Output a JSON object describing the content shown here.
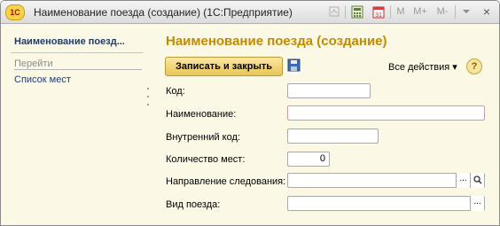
{
  "window": {
    "title": "Наименование поезда (создание)  (1С:Предприятие)",
    "app_icon_text": "1С",
    "toolbar": {
      "m_label": "M",
      "m_plus_label": "M+",
      "m_minus_label": "M-",
      "close_label": "×"
    }
  },
  "left_panel": {
    "title": "Наименование поезд...",
    "section": "Перейти",
    "links": [
      "Список мест"
    ]
  },
  "form": {
    "title": "Наименование поезда (создание)",
    "save_close_label": "Записать и закрыть",
    "all_actions_label": "Все действия ▾",
    "help_label": "?",
    "fields": {
      "code_label": "Код:",
      "code_value": "",
      "name_label": "Наименование:",
      "name_value": "",
      "internal_code_label": "Внутренний код:",
      "internal_code_value": "",
      "seats_label": "Количество мест:",
      "seats_value": "0",
      "direction_label": "Направление следования:",
      "direction_value": "",
      "train_type_label": "Вид поезда:",
      "train_type_value": ""
    },
    "field_button_label": "..."
  }
}
